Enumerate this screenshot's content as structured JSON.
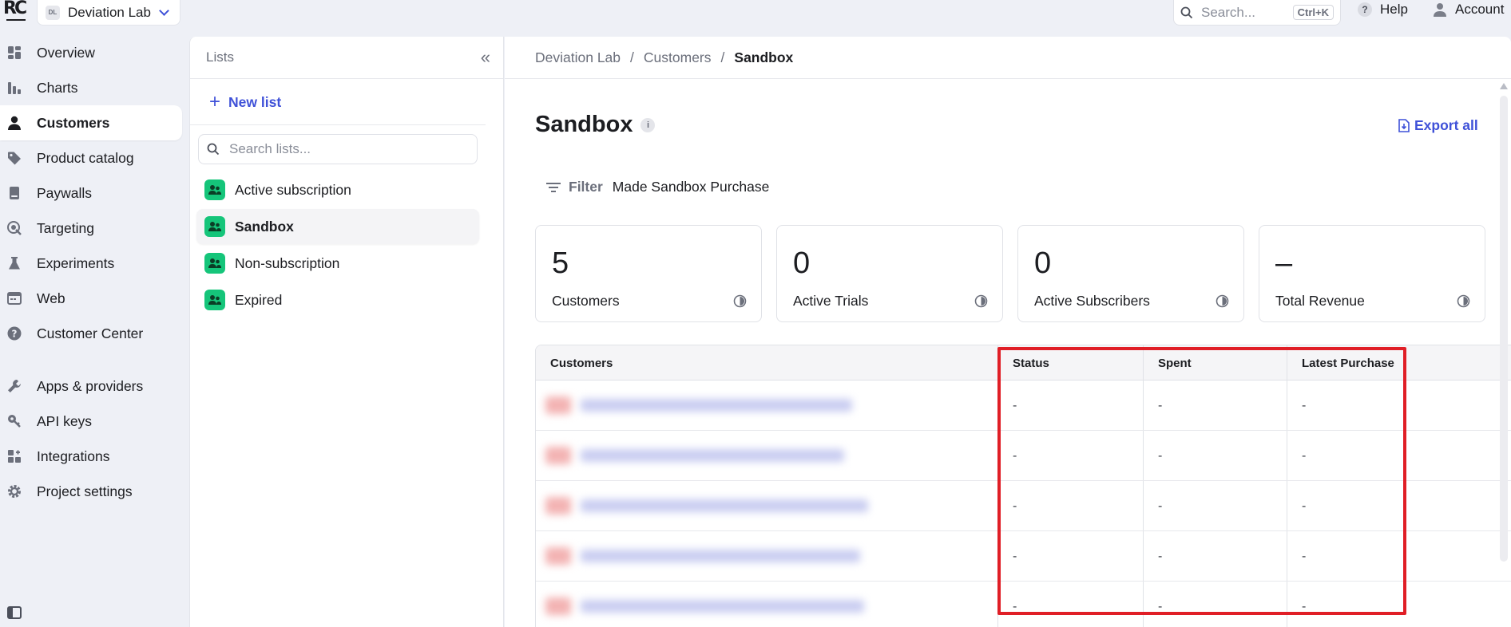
{
  "brand": {
    "logo_text": "RC"
  },
  "project": {
    "badge": "DL",
    "name": "Deviation Lab"
  },
  "topbar": {
    "search_placeholder": "Search...",
    "search_shortcut": "Ctrl+K",
    "help_label": "Help",
    "account_label": "Account"
  },
  "sidebar": {
    "items": [
      {
        "label": "Overview",
        "icon": "grid-icon"
      },
      {
        "label": "Charts",
        "icon": "bar-chart-icon"
      },
      {
        "label": "Customers",
        "icon": "user-icon",
        "active": true
      },
      {
        "label": "Product catalog",
        "icon": "tag-icon"
      },
      {
        "label": "Paywalls",
        "icon": "paywall-icon"
      },
      {
        "label": "Targeting",
        "icon": "target-icon"
      },
      {
        "label": "Experiments",
        "icon": "flask-icon"
      },
      {
        "label": "Web",
        "icon": "web-icon"
      },
      {
        "label": "Customer Center",
        "icon": "help-circle-icon"
      },
      {
        "label": "Apps & providers",
        "icon": "wrench-icon"
      },
      {
        "label": "API keys",
        "icon": "key-icon"
      },
      {
        "label": "Integrations",
        "icon": "puzzle-icon"
      },
      {
        "label": "Project settings",
        "icon": "gear-icon"
      }
    ]
  },
  "lists": {
    "title": "Lists",
    "new_list_label": "New list",
    "search_placeholder": "Search lists...",
    "items": [
      {
        "label": "Active subscription"
      },
      {
        "label": "Sandbox",
        "selected": true
      },
      {
        "label": "Non-subscription"
      },
      {
        "label": "Expired"
      }
    ]
  },
  "breadcrumb": {
    "root": "Deviation Lab",
    "section": "Customers",
    "current": "Sandbox",
    "separator": "/"
  },
  "page": {
    "title": "Sandbox",
    "export_label": "Export all",
    "filter_label": "Filter",
    "filter_value": "Made Sandbox Purchase"
  },
  "stats": [
    {
      "value": "5",
      "label": "Customers"
    },
    {
      "value": "0",
      "label": "Active Trials"
    },
    {
      "value": "0",
      "label": "Active Subscribers"
    },
    {
      "value": "–",
      "label": "Total Revenue"
    }
  ],
  "table": {
    "columns": [
      "Customers",
      "Status",
      "Spent",
      "Latest Purchase"
    ],
    "rows": [
      {
        "status": "-",
        "spent": "-",
        "latest": "-"
      },
      {
        "status": "-",
        "spent": "-",
        "latest": "-"
      },
      {
        "status": "-",
        "spent": "-",
        "latest": "-"
      },
      {
        "status": "-",
        "spent": "-",
        "latest": "-"
      },
      {
        "status": "-",
        "spent": "-",
        "latest": "-"
      }
    ]
  },
  "colors": {
    "accent": "#3f51d8",
    "list_badge": "#15c57a",
    "highlight": "#e01e26",
    "background": "#eef0f6"
  }
}
